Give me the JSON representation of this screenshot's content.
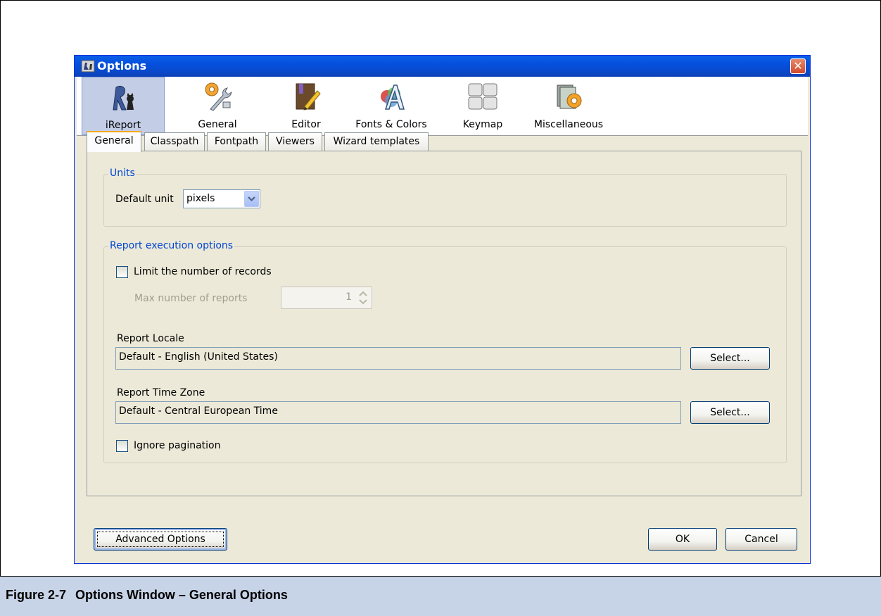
{
  "window": {
    "title": "Options"
  },
  "categories": [
    {
      "label": "iReport",
      "icon": "ireport-icon",
      "selected": true
    },
    {
      "label": "General",
      "icon": "wrench-gear-icon",
      "selected": false
    },
    {
      "label": "Editor",
      "icon": "book-pencil-icon",
      "selected": false
    },
    {
      "label": "Fonts & Colors",
      "icon": "font-palette-icon",
      "selected": false
    },
    {
      "label": "Keymap",
      "icon": "keyboard-icon",
      "selected": false
    },
    {
      "label": "Miscellaneous",
      "icon": "misc-gear-icon",
      "selected": false
    }
  ],
  "tabs": [
    {
      "label": "General",
      "active": true
    },
    {
      "label": "Classpath",
      "active": false
    },
    {
      "label": "Fontpath",
      "active": false
    },
    {
      "label": "Viewers",
      "active": false
    },
    {
      "label": "Wizard templates",
      "active": false
    }
  ],
  "units": {
    "legend": "Units",
    "default_unit_label": "Default unit",
    "default_unit_value": "pixels"
  },
  "execution": {
    "legend": "Report execution options",
    "limit_records_label": "Limit the number of records",
    "limit_records_checked": false,
    "max_reports_label": "Max number of reports",
    "max_reports_value": "1",
    "locale_label": "Report Locale",
    "locale_value": "Default - English (United States)",
    "locale_select": "Select...",
    "timezone_label": "Report Time Zone",
    "timezone_value": "Default - Central European Time",
    "timezone_select": "Select...",
    "ignore_pagination_label": "Ignore pagination",
    "ignore_pagination_checked": false
  },
  "footer": {
    "advanced_label": "Advanced Options",
    "ok_label": "OK",
    "cancel_label": "Cancel"
  },
  "caption": {
    "number": "Figure 2-7",
    "title": "Options Window – General Options"
  },
  "colors": {
    "titlebar": "#0a54e0",
    "dialog_bg": "#ece9d8",
    "legend_text": "#0046d5",
    "caption_bg": "#c7d3e6"
  }
}
